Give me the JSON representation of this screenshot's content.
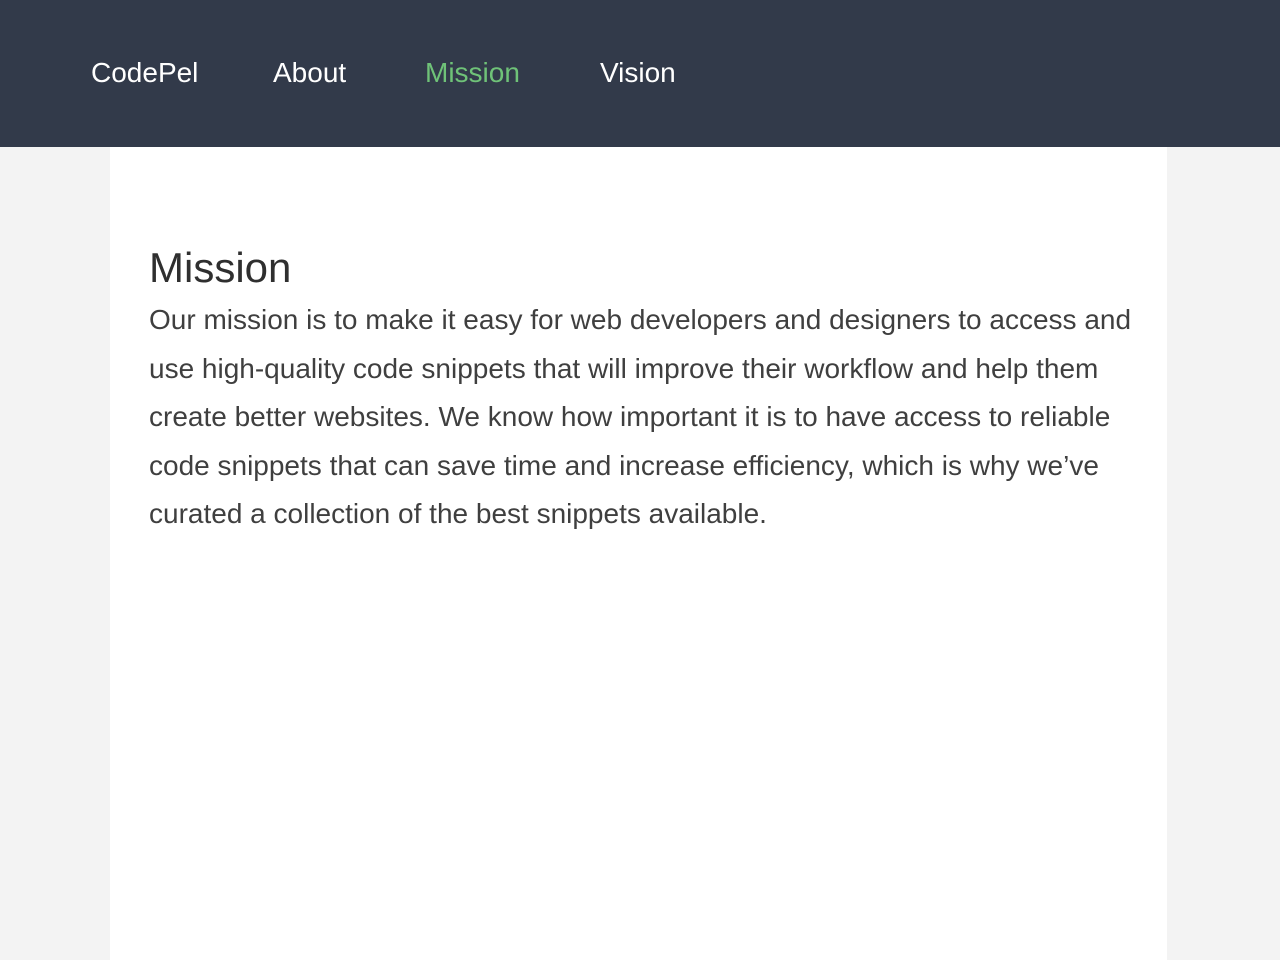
{
  "nav": {
    "items": [
      {
        "label": "CodePel",
        "active": false
      },
      {
        "label": "About",
        "active": false
      },
      {
        "label": "Mission",
        "active": true
      },
      {
        "label": "Vision",
        "active": false
      }
    ]
  },
  "main": {
    "title": "Mission",
    "body": "Our mission is to make it easy for web developers and designers to access and use high-quality code snippets that will improve their workflow and help them create better websites. We know how important it is to have access to reliable code snippets that can save time and increase efficiency, which is why we’ve curated a collection of the best snippets available."
  },
  "colors": {
    "nav_background": "#323a4a",
    "nav_text": "#ffffff",
    "nav_active": "#6fc278",
    "page_background": "#f3f3f3",
    "panel_background": "#ffffff",
    "heading_text": "#2f2f2f",
    "body_text": "#3f3f3f"
  }
}
